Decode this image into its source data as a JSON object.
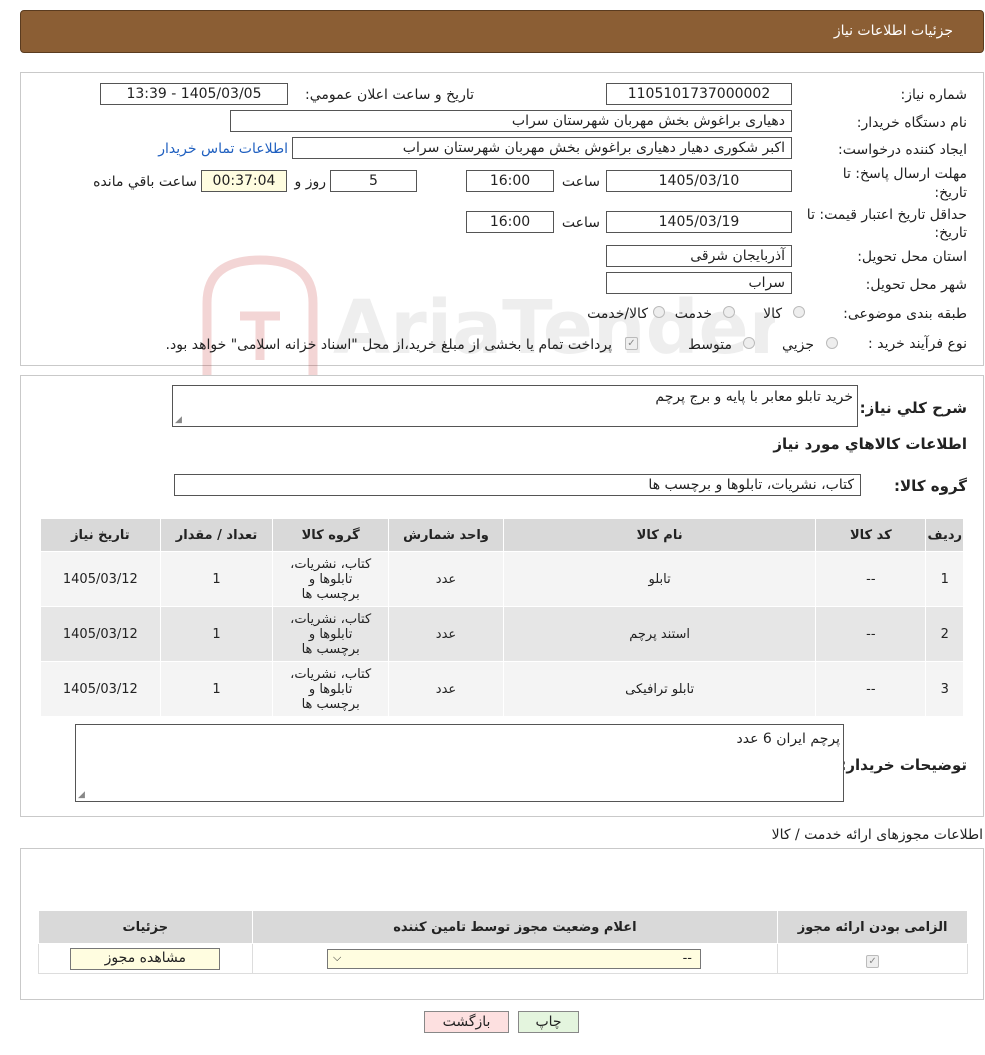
{
  "header": {
    "title": "جزئیات اطلاعات نیاز"
  },
  "form": {
    "need_number_label": "شماره نیاز:",
    "need_number": "1105101737000002",
    "announce_label": "تاریخ و ساعت اعلان عمومي:",
    "announce_value": "1405/03/05 - 13:39",
    "buyer_org_label": "نام دستگاه خريدار:",
    "buyer_org": "دهیاری براغوش بخش مهربان شهرستان سراب",
    "requester_label": "ايجاد کننده درخواست:",
    "requester": "اکبر شکوری دهیار دهیاری براغوش بخش مهربان شهرستان سراب",
    "contact_link": "اطلاعات تماس خريدار",
    "deadline_label_1": "مهلت ارسال پاسخ: تا",
    "deadline_label_2": "تاريخ:",
    "deadline_date": "1405/03/10",
    "time_label": "ساعت",
    "deadline_time": "16:00",
    "days_value": "5",
    "days_label": "روز و",
    "remaining_value": "00:37:04",
    "remaining_label": "ساعت باقي مانده",
    "validity_label_1": "حداقل تاريخ اعتبار قيمت: تا",
    "validity_label_2": "تاريخ:",
    "validity_date": "1405/03/19",
    "validity_time": "16:00",
    "province_label": "استان محل تحويل:",
    "province": "آذربایجان شرقی",
    "city_label": "شهر محل تحويل:",
    "city": "سراب",
    "category_label": "طبقه بندی موضوعی:",
    "category_options": [
      "کالا",
      "خدمت",
      "کالا/خدمت"
    ],
    "process_label": "نوع فرآيند خريد :",
    "process_options": [
      "جزيي",
      "متوسط"
    ],
    "payment_note": "پرداخت تمام یا بخشی از مبلغ خرید،از محل \"اسناد خزانه اسلامی\" خواهد بود."
  },
  "details": {
    "summary_label": "شرح کلي نياز:",
    "summary": "خرید تابلو معابر با پایه و برج پرچم",
    "goods_info_title": "اطلاعات کالاهاي مورد نياز",
    "goods_group_label": "گروه کالا:",
    "goods_group": "کتاب، نشريات، تابلوها و برچسب ها",
    "table": {
      "headers": [
        "رديف",
        "کد کالا",
        "نام کالا",
        "واحد شمارش",
        "گروه کالا",
        "تعداد / مقدار",
        "تاريخ نياز"
      ],
      "rows": [
        [
          "1",
          "--",
          "تابلو",
          "عدد",
          "کتاب، نشريات، تابلوها و برچسب ها",
          "1",
          "1405/03/12"
        ],
        [
          "2",
          "--",
          "استند پرچم",
          "عدد",
          "کتاب، نشريات، تابلوها و برچسب ها",
          "1",
          "1405/03/12"
        ],
        [
          "3",
          "--",
          "تابلو ترافیکی",
          "عدد",
          "کتاب، نشريات، تابلوها و برچسب ها",
          "1",
          "1405/03/12"
        ]
      ]
    },
    "buyer_notes_label": "توضيحات خريدار:",
    "buyer_notes": "پرچم ایران 6 عدد"
  },
  "permits": {
    "title": "اطلاعات مجوزهای ارائه خدمت / کالا",
    "headers": [
      "الزامی بودن ارائه مجوز",
      "اعلام وضعيت مجوز توسط تامين کننده",
      "جزئيات"
    ],
    "select_value": "--",
    "view_button": "مشاهده مجوز"
  },
  "actions": {
    "print": "چاپ",
    "back": "بازگشت"
  },
  "watermark": {
    "text": "AriaTender.neT"
  },
  "colors": {
    "header_bg": "#8b5e34",
    "back_button_bg": "#fde0e0",
    "print_button_bg": "#e4f5de"
  }
}
